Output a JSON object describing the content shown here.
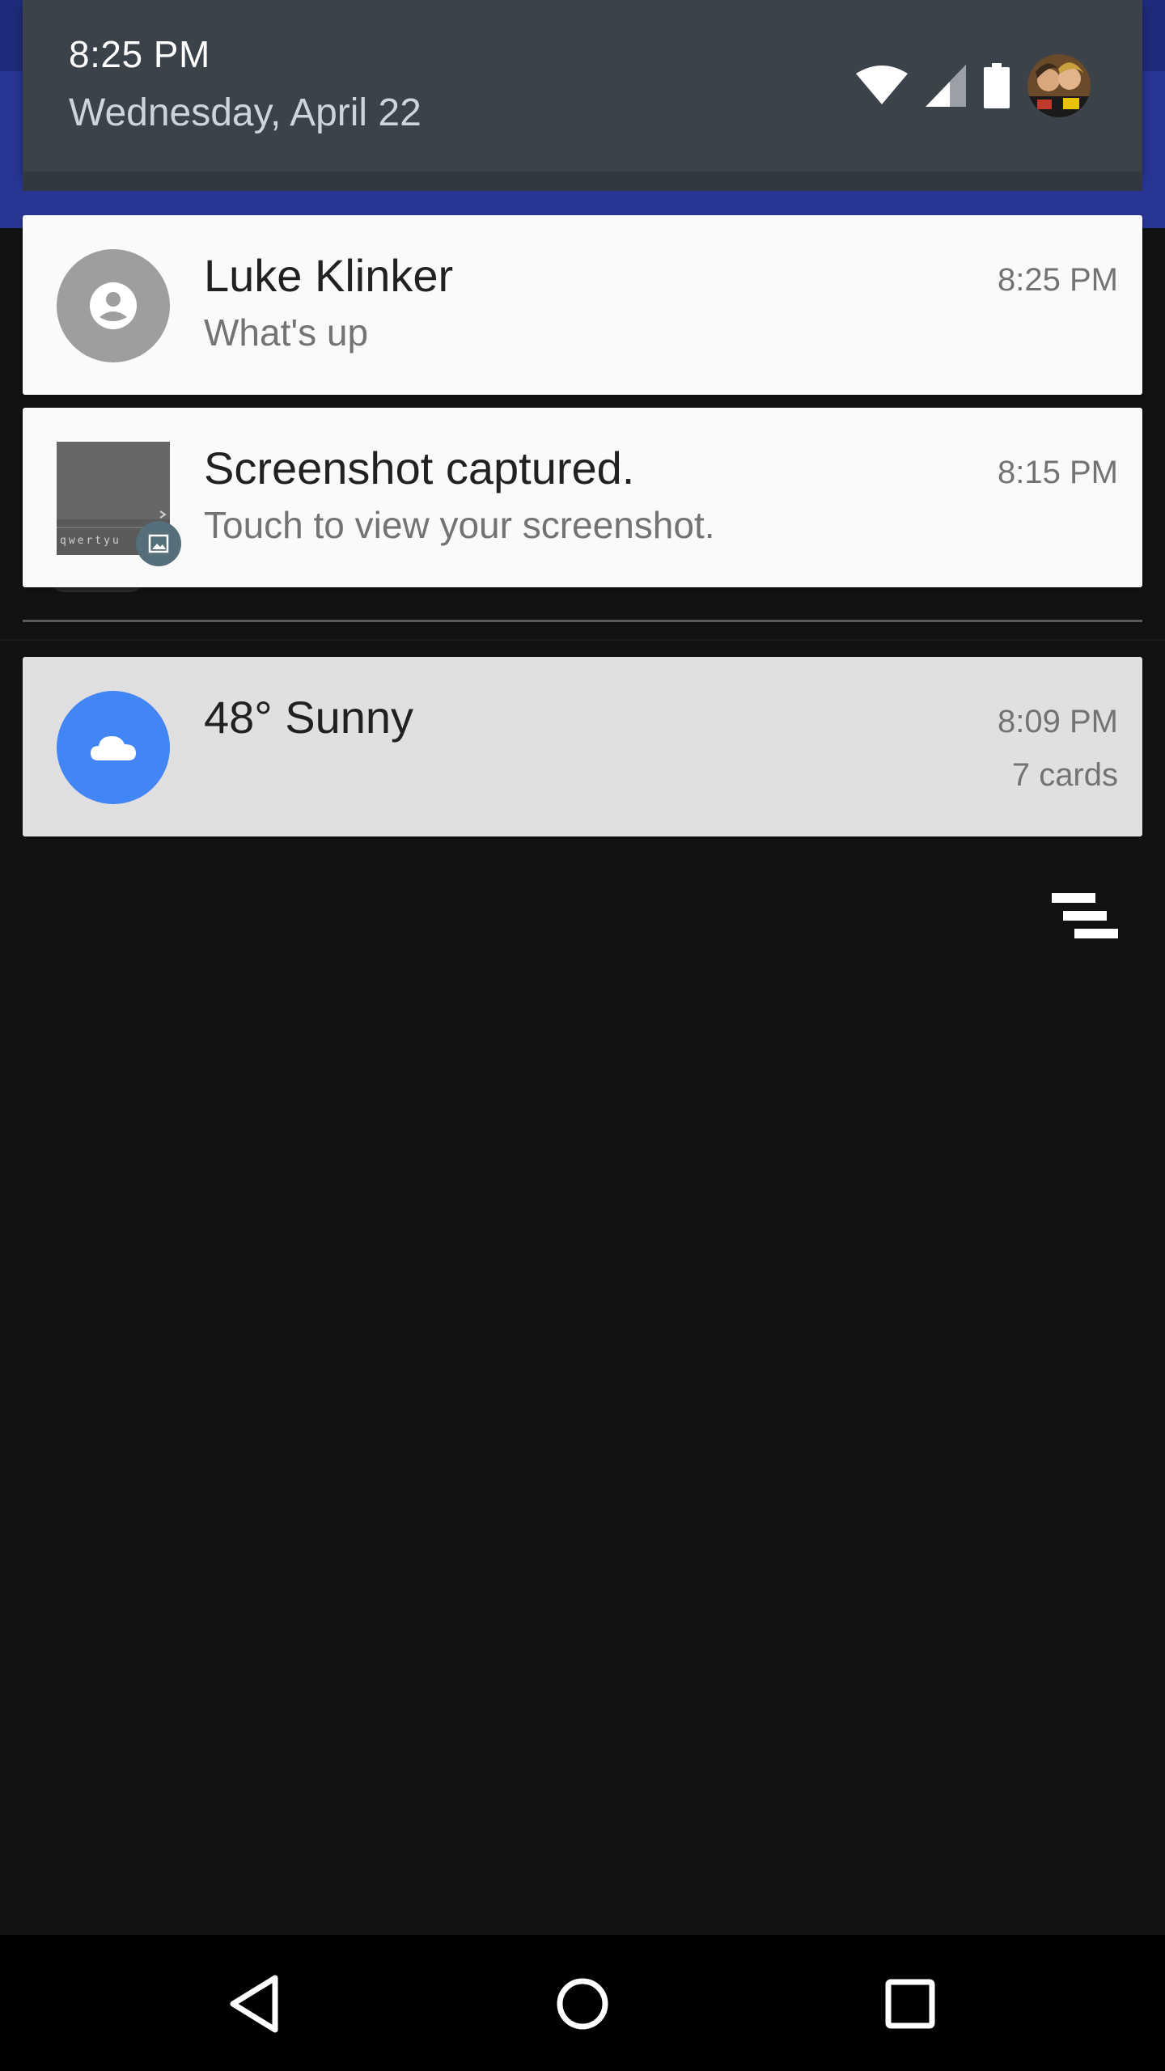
{
  "status": {
    "time": "8:25 PM",
    "date": "Wednesday, April 22",
    "icons": [
      "wifi-icon",
      "cell-signal-icon",
      "battery-icon",
      "user-avatar"
    ]
  },
  "notifications": [
    {
      "app_icon": "contact-person-icon",
      "icon_color": "#9e9e9e",
      "title": "Luke Klinker",
      "text": "What's up",
      "time": "8:25 PM"
    },
    {
      "app_icon": "screenshot-thumbnail",
      "badge_icon": "image-icon",
      "title": "Screenshot captured.",
      "text": "Touch to view your screenshot.",
      "time": "8:15 PM"
    },
    {
      "app_icon": "cloud-icon",
      "icon_color": "#4285f4",
      "title": "48° Sunny",
      "time": "8:09 PM",
      "count": "7 cards"
    }
  ],
  "actions": {
    "clear_all_icon": "clear-all-icon"
  },
  "navigation": {
    "buttons": [
      "back-icon",
      "home-icon",
      "recents-icon"
    ]
  },
  "colors": {
    "header": "#3b4249",
    "app_bar": "#283593",
    "background": "#121212",
    "weather_accent": "#4285f4"
  }
}
